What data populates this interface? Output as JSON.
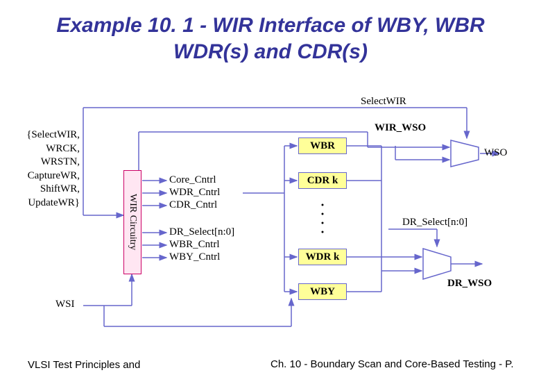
{
  "title": "Example 10. 1 - WIR Interface of WBY, WBR WDR(s) and CDR(s)",
  "signals": {
    "top": "SelectWIR",
    "group": "{SelectWIR,\nWRCK,\nWRSTN,\nCaptureWR,\nShiftWR,\nUpdateWR}",
    "ctrl_top": [
      "Core_Cntrl",
      "WDR_Cntrl",
      "CDR_Cntrl"
    ],
    "ctrl_bot": [
      "DR_Select[n:0]",
      "WBR_Cntrl",
      "WBY_Cntrl"
    ],
    "wir_wso": "WIR_WSO",
    "wso": "WSO",
    "dr_select": "DR_Select[n:0]",
    "dr_wso": "DR_WSO",
    "wsi": "WSI"
  },
  "blocks": {
    "wir": "WIR Circuitry",
    "wbr": "WBR",
    "cdrk": "CDR k",
    "wdrk": "WDR k",
    "wby": "WBY"
  },
  "footer": {
    "left": "VLSI Test Principles and",
    "right": "Ch. 10 - Boundary Scan and Core-Based Testing - P."
  },
  "colors": {
    "wire": "#6666cc",
    "block_border": "#6666cc",
    "block_fill": "#ffff99",
    "wir_border": "#cc0066",
    "wir_fill": "#ffe6f2",
    "title": "#333399"
  }
}
